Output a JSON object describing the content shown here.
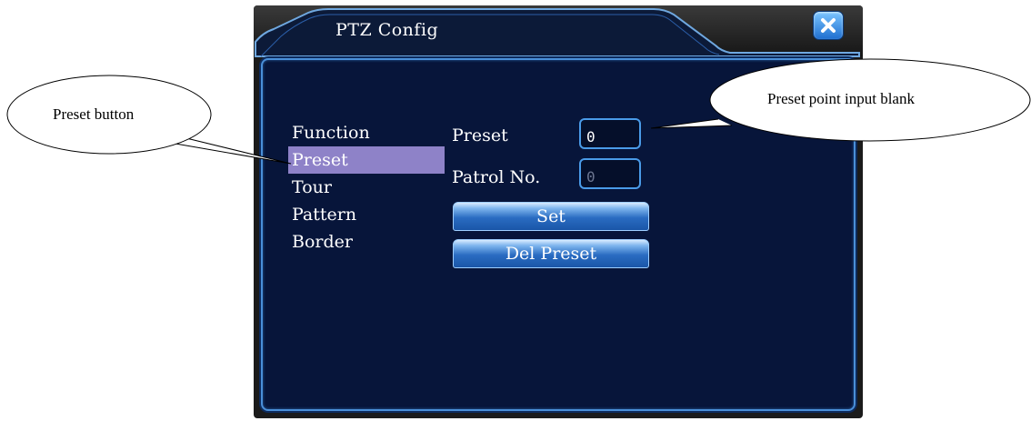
{
  "dialog": {
    "title": "PTZ Config",
    "close_icon": "close-x-icon"
  },
  "nav": {
    "items": [
      {
        "label": "Function",
        "selected": false
      },
      {
        "label": "Preset",
        "selected": true
      },
      {
        "label": "Tour",
        "selected": false
      },
      {
        "label": "Pattern",
        "selected": false
      },
      {
        "label": "Border",
        "selected": false
      }
    ]
  },
  "form": {
    "preset_label": "Preset",
    "preset_value": "0",
    "patrol_label": "Patrol No.",
    "patrol_value": "0",
    "set_button": "Set",
    "del_preset_button": "Del Preset"
  },
  "callouts": {
    "preset_button": "Preset button",
    "preset_input": "Preset point input blank"
  },
  "colors": {
    "accent_blue": "#4a9be8",
    "content_bg": "#07153a",
    "selected_nav": "#8e82c8"
  }
}
